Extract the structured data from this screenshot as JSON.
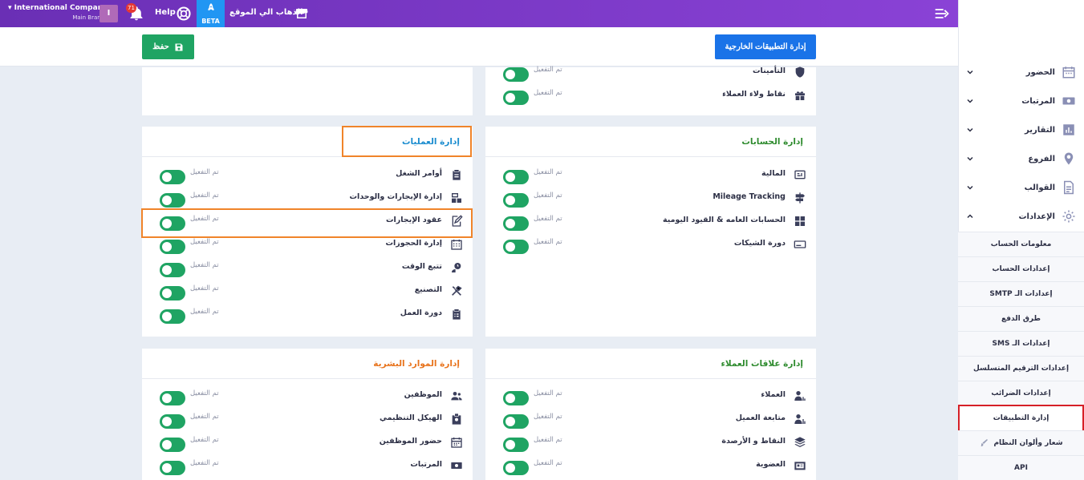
{
  "topbar": {
    "company": "International Company",
    "branch": "Main Branch",
    "avatar_initial": "I",
    "notif_count": "71",
    "help": "Help",
    "beta": "BETA",
    "goto_site": "الذهاب الي الموقع"
  },
  "header": {
    "external_apps_button": "إدارة التطبيقات الخارجية",
    "save_button": "حفظ"
  },
  "status_text": "تم التفعيل",
  "cards": {
    "top_right": {
      "rows": [
        {
          "label": "التأمينات",
          "icon": "shield-icon",
          "status": "تم التفعيل"
        },
        {
          "label": "نقاط ولاء العملاء",
          "icon": "gift-icon",
          "status": "تم التفعيل"
        }
      ]
    },
    "accounts": {
      "title": "إدارة الحسابات",
      "title_color": "#2e8b2e",
      "rows": [
        {
          "label": "المالية",
          "icon": "finance-icon",
          "status": "تم التفعيل"
        },
        {
          "label": "Mileage Tracking",
          "icon": "signpost-icon",
          "status": "تم التفعيل"
        },
        {
          "label": "الحسابات العامه & القيود اليومية",
          "icon": "ledger-icon",
          "status": "تم التفعيل"
        },
        {
          "label": "دورة الشيكات",
          "icon": "cheque-icon",
          "status": "تم التفعيل"
        }
      ]
    },
    "operations": {
      "title": "إدارة العمليات",
      "title_color": "#1a8ccf",
      "rows": [
        {
          "label": "أوامر الشغل",
          "icon": "clipboard-icon",
          "status": "تم التفعيل"
        },
        {
          "label": "إدارة الإيجارات والوحدات",
          "icon": "units-icon",
          "status": "تم التفعيل"
        },
        {
          "label": "عقود الإيجارات",
          "icon": "contract-icon",
          "status": "تم التفعيل"
        },
        {
          "label": "إدارة الحجوزات",
          "icon": "calendar-grid-icon",
          "status": "تم التفعيل"
        },
        {
          "label": "تتبع الوقت",
          "icon": "time-tracking-icon",
          "status": "تم التفعيل"
        },
        {
          "label": "التصنيع",
          "icon": "tools-icon",
          "status": "تم التفعيل"
        },
        {
          "label": "دورة العمل",
          "icon": "clipboard-list-icon",
          "status": "تم التفعيل"
        }
      ]
    },
    "crm": {
      "title": "إدارة علاقات العملاء",
      "title_color": "#2e8b2e",
      "rows": [
        {
          "label": "العملاء",
          "icon": "client-icon",
          "status": "تم التفعيل"
        },
        {
          "label": "متابعة العميل",
          "icon": "client-followup-icon",
          "status": "تم التفعيل"
        },
        {
          "label": "النقاط و الأرصدة",
          "icon": "layers-icon",
          "status": "تم التفعيل"
        },
        {
          "label": "العضوية",
          "icon": "membership-card-icon",
          "status": "تم التفعيل"
        }
      ]
    },
    "hr": {
      "title": "إدارة الموارد البشرية",
      "title_color": "#e8731c",
      "rows": [
        {
          "label": "الموظفين",
          "icon": "users-icon",
          "status": "تم التفعيل"
        },
        {
          "label": "الهيكل التنظيمي",
          "icon": "org-badge-icon",
          "status": "تم التفعيل"
        },
        {
          "label": "حضور الموظفين",
          "icon": "calendar-icon",
          "status": "تم التفعيل"
        },
        {
          "label": "المرتبات",
          "icon": "money-icon",
          "status": "تم التفعيل"
        }
      ]
    }
  },
  "sidebar": {
    "items": [
      {
        "label": "الحضور",
        "icon": "calendar-icon"
      },
      {
        "label": "المرتبات",
        "icon": "money-icon"
      },
      {
        "label": "التقارير",
        "icon": "bar-chart-icon"
      },
      {
        "label": "الفروع",
        "icon": "map-pin-icon"
      },
      {
        "label": "القوالب",
        "icon": "document-icon"
      },
      {
        "label": "الإعدادات",
        "icon": "gear-icon"
      }
    ],
    "settings_sub": [
      "معلومات الحساب",
      "إعدادات الحساب",
      "إعدادات الـ SMTP",
      "طرق الدفع",
      "إعدادات الـ SMS",
      "إعدادات الترقيم المتسلسل",
      "إعدادات الضرائب",
      "إدارة التطبيقات",
      "شعار وألوان النظام",
      "API"
    ]
  },
  "colors": {
    "topbar": "#7b38c9",
    "accent_blue": "#1a73e8",
    "save_green": "#1fa463",
    "highlight_orange": "#f0842a",
    "highlight_red": "#d62027"
  }
}
